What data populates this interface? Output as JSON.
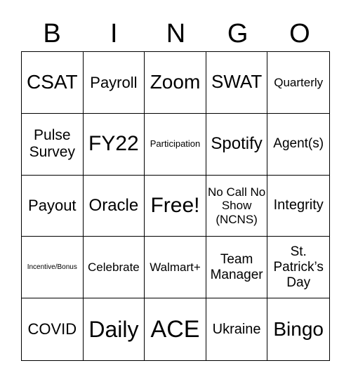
{
  "header": [
    "B",
    "I",
    "N",
    "G",
    "O"
  ],
  "cells": [
    "CSAT",
    "Payroll",
    "Zoom",
    "SWAT",
    "Quarterly",
    "Pulse Survey",
    "FY22",
    "Participation",
    "Spotify",
    "Agent(s)",
    "Payout",
    "Oracle",
    "Free!",
    "No Call No Show (NCNS)",
    "Integrity",
    "Incentive/Bonus",
    "Celebrate",
    "Walmart+",
    "Team Manager",
    "St. Patrick’s Day",
    "COVID",
    "Daily",
    "ACE",
    "Ukraine",
    "Bingo"
  ]
}
